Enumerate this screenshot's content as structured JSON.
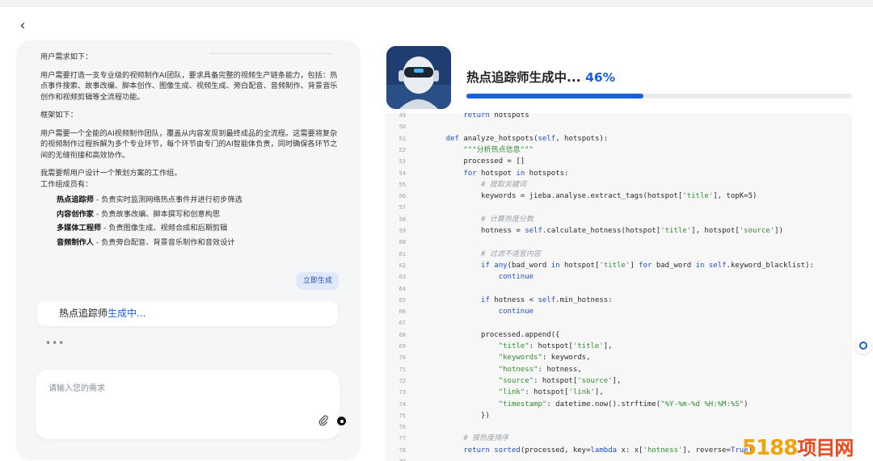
{
  "nav": {
    "back": "‹"
  },
  "prompt": {
    "p1": "用户需求如下：",
    "p2": "用户需要打造一支专业级的视频制作AI团队，要求具备完整的视频生产链条能力，包括：热点事件搜索、故事改编、脚本创作、图像生成、视频生成、旁白配音、音频制作、背景音乐创作和视频剪辑等全流程功能。",
    "p3": "框架如下：",
    "p4": "用户需要一个全能的AI视频制作团队，覆盖从内容发现到最终成品的全流程。这需要将复杂的视频制作过程拆解为多个专业环节，每个环节由专门的AI智能体负责，同时确保各环节之间的无缝衔接和高效协作。",
    "p5": "我需要帮用户设计一个策划方案的工作组。",
    "p6": "工作组成员有：",
    "members": [
      {
        "name": "热点追踪师",
        "desc": " - 负责实时监测网络热点事件并进行初步筛选"
      },
      {
        "name": "内容创作家",
        "desc": " - 负责故事改编、脚本撰写和创意构思"
      },
      {
        "name": "多媒体工程师",
        "desc": " - 负责图像生成、视频合成和后期剪辑"
      },
      {
        "name": "音频制作人",
        "desc": " - 负责旁白配音、背景音乐制作和音效设计"
      }
    ]
  },
  "generate_button": "立即生成",
  "status": {
    "name": "热点追踪师",
    "state": "生成中..."
  },
  "typing": "•••",
  "input": {
    "placeholder": "请输入您的需求"
  },
  "progress": {
    "title": "热点追踪师生成中...",
    "percent_label": "46%",
    "value": 0.46
  },
  "code_lines": [
    {
      "n": "49",
      "t": "        return hotspots"
    },
    {
      "n": "50",
      "t": ""
    },
    {
      "n": "51",
      "t": "    def analyze_hotspots(self, hotspots):"
    },
    {
      "n": "52",
      "t": "        \"\"\"分析热点信息\"\"\""
    },
    {
      "n": "53",
      "t": "        processed = []"
    },
    {
      "n": "54",
      "t": "        for hotspot in hotspots:"
    },
    {
      "n": "55",
      "t": "            # 提取关键词"
    },
    {
      "n": "56",
      "t": "            keywords = jieba.analyse.extract_tags(hotspot['title'], topK=5)"
    },
    {
      "n": "57",
      "t": ""
    },
    {
      "n": "58",
      "t": "            # 计算热度分数"
    },
    {
      "n": "59",
      "t": "            hotness = self.calculate_hotness(hotspot['title'], hotspot['source'])"
    },
    {
      "n": "60",
      "t": ""
    },
    {
      "n": "61",
      "t": "            # 过滤不适宜内容"
    },
    {
      "n": "62",
      "t": "            if any(bad_word in hotspot['title'] for bad_word in self.keyword_blacklist):"
    },
    {
      "n": "63",
      "t": "                continue"
    },
    {
      "n": "64",
      "t": ""
    },
    {
      "n": "65",
      "t": "            if hotness < self.min_hotness:"
    },
    {
      "n": "66",
      "t": "                continue"
    },
    {
      "n": "67",
      "t": ""
    },
    {
      "n": "68",
      "t": "            processed.append({"
    },
    {
      "n": "69",
      "t": "                \"title\": hotspot['title'],"
    },
    {
      "n": "70",
      "t": "                \"keywords\": keywords,"
    },
    {
      "n": "71",
      "t": "                \"hotness\": hotness,"
    },
    {
      "n": "72",
      "t": "                \"source\": hotspot['source'],"
    },
    {
      "n": "73",
      "t": "                \"link\": hotspot['link'],"
    },
    {
      "n": "74",
      "t": "                \"timestamp\": datetime.now().strftime(\"%Y-%m-%d %H:%M:%S\")"
    },
    {
      "n": "75",
      "t": "            })"
    },
    {
      "n": "76",
      "t": ""
    },
    {
      "n": "77",
      "t": "        # 按热度排序"
    },
    {
      "n": "78",
      "t": "        return sorted(processed, key=lambda x: x['hotness'], reverse=True)"
    },
    {
      "n": "79",
      "t": ""
    }
  ],
  "watermark": {
    "num": "5188",
    "cn": "项目网"
  },
  "colors": {
    "accent": "#1a5fe0",
    "panel": "#f5f6f8",
    "code_bg": "#f7f7f8"
  },
  "icons": {
    "back": "chevron-left-icon",
    "attach": "paperclip-icon",
    "send": "send-icon",
    "float": "assistant-icon"
  }
}
